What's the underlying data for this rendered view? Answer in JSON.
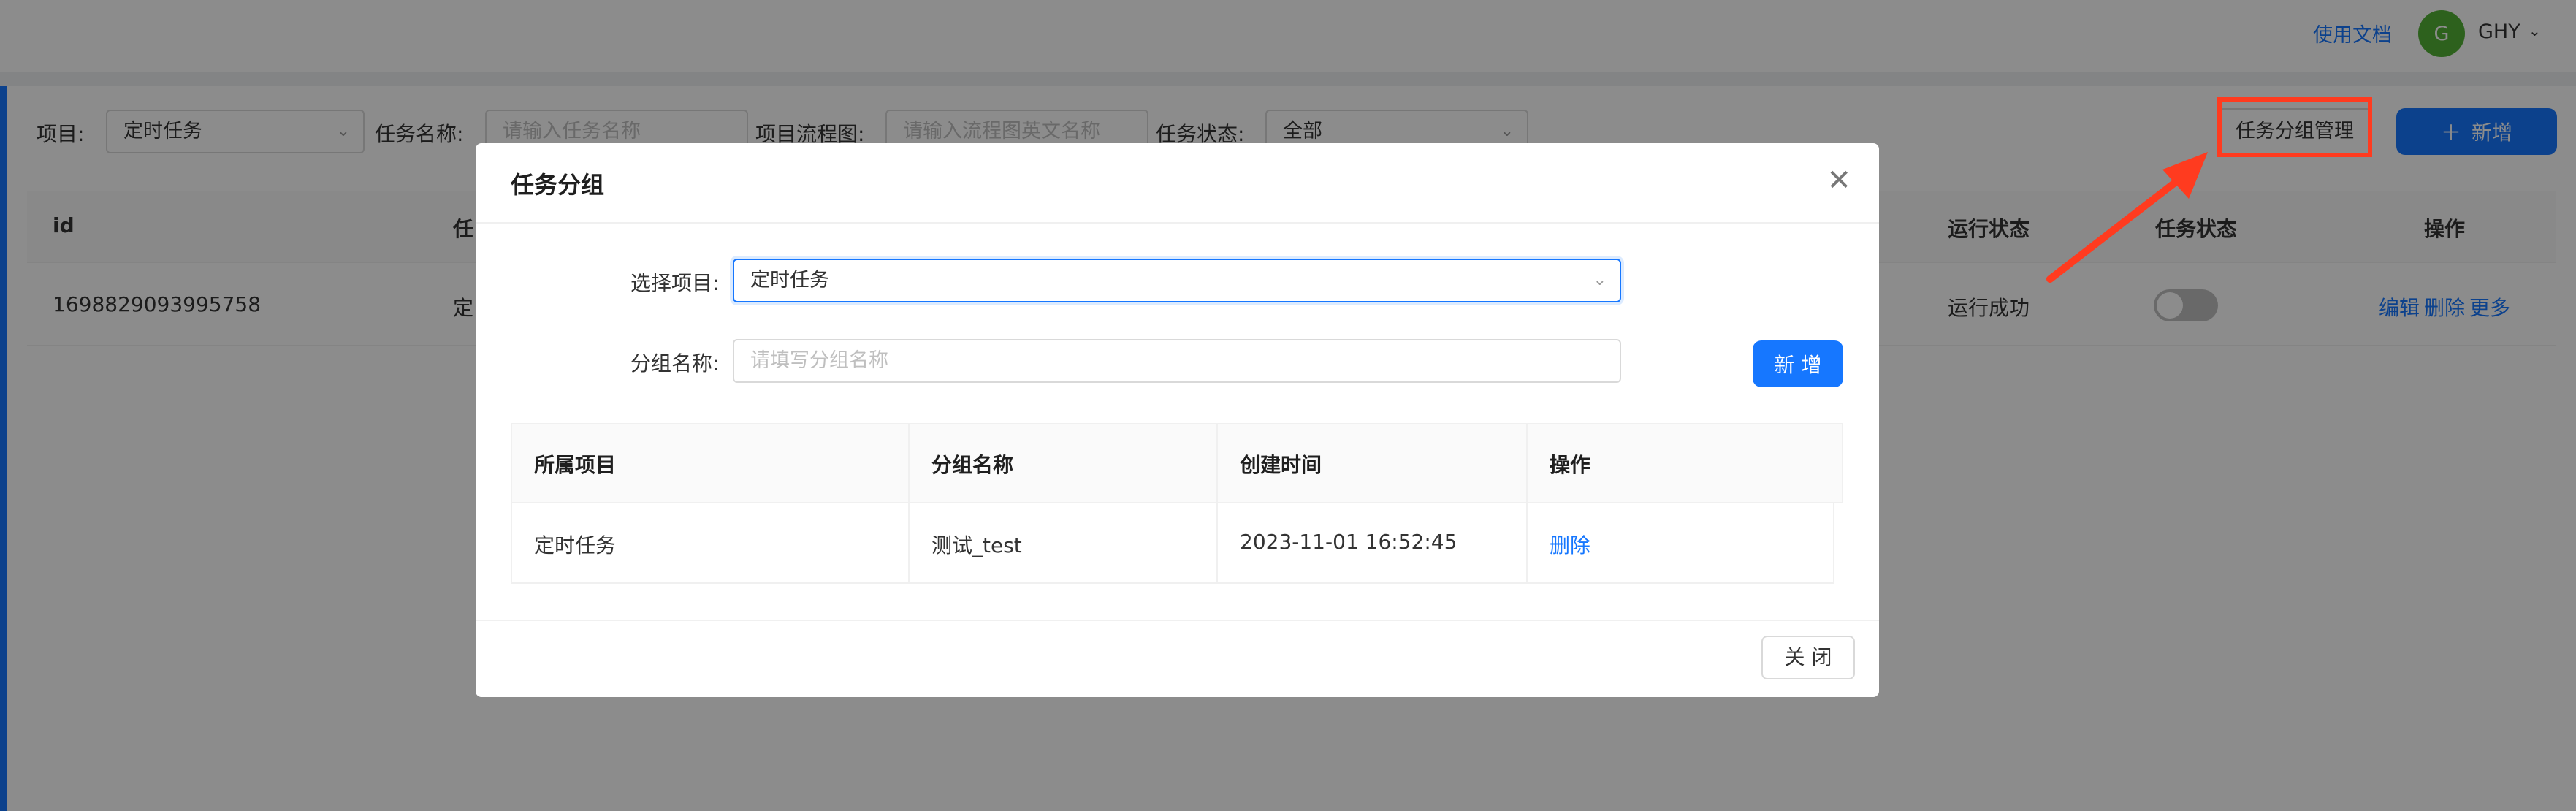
{
  "header": {
    "docs_link": "使用文档",
    "avatar_letter": "G",
    "user_name": "GHY"
  },
  "filters": {
    "project_label": "项目:",
    "project_value": "定时任务",
    "task_name_label": "任务名称:",
    "task_name_placeholder": "请输入任务名称",
    "flow_label": "项目流程图:",
    "flow_placeholder": "请输入流程图英文名称",
    "status_label": "任务状态:",
    "status_value": "全部"
  },
  "toolbar": {
    "group_mgmt_label": "任务分组管理",
    "add_label": "新增"
  },
  "table": {
    "headers": [
      "id",
      "任",
      "运行状态",
      "任务状态",
      "操作"
    ],
    "row": {
      "id": "1698829093995758",
      "task_partial": "定",
      "run_status": "运行成功",
      "task_status_enabled": false,
      "actions": [
        "编辑",
        "删除",
        "更多"
      ]
    }
  },
  "modal": {
    "title": "任务分组",
    "select_project_label": "选择项目:",
    "select_project_value": "定时任务",
    "group_name_label": "分组名称:",
    "group_name_placeholder": "请填写分组名称",
    "add_button": "新 增",
    "columns": [
      "所属项目",
      "分组名称",
      "创建时间",
      "操作"
    ],
    "rows": [
      {
        "project": "定时任务",
        "group": "测试_test",
        "created": "2023-11-01 16:52:45",
        "action": "删除"
      }
    ],
    "close_button": "关 闭"
  },
  "colors": {
    "primary": "#1677ff",
    "avatar": "#52b136",
    "annotation": "#ff3b1f"
  }
}
